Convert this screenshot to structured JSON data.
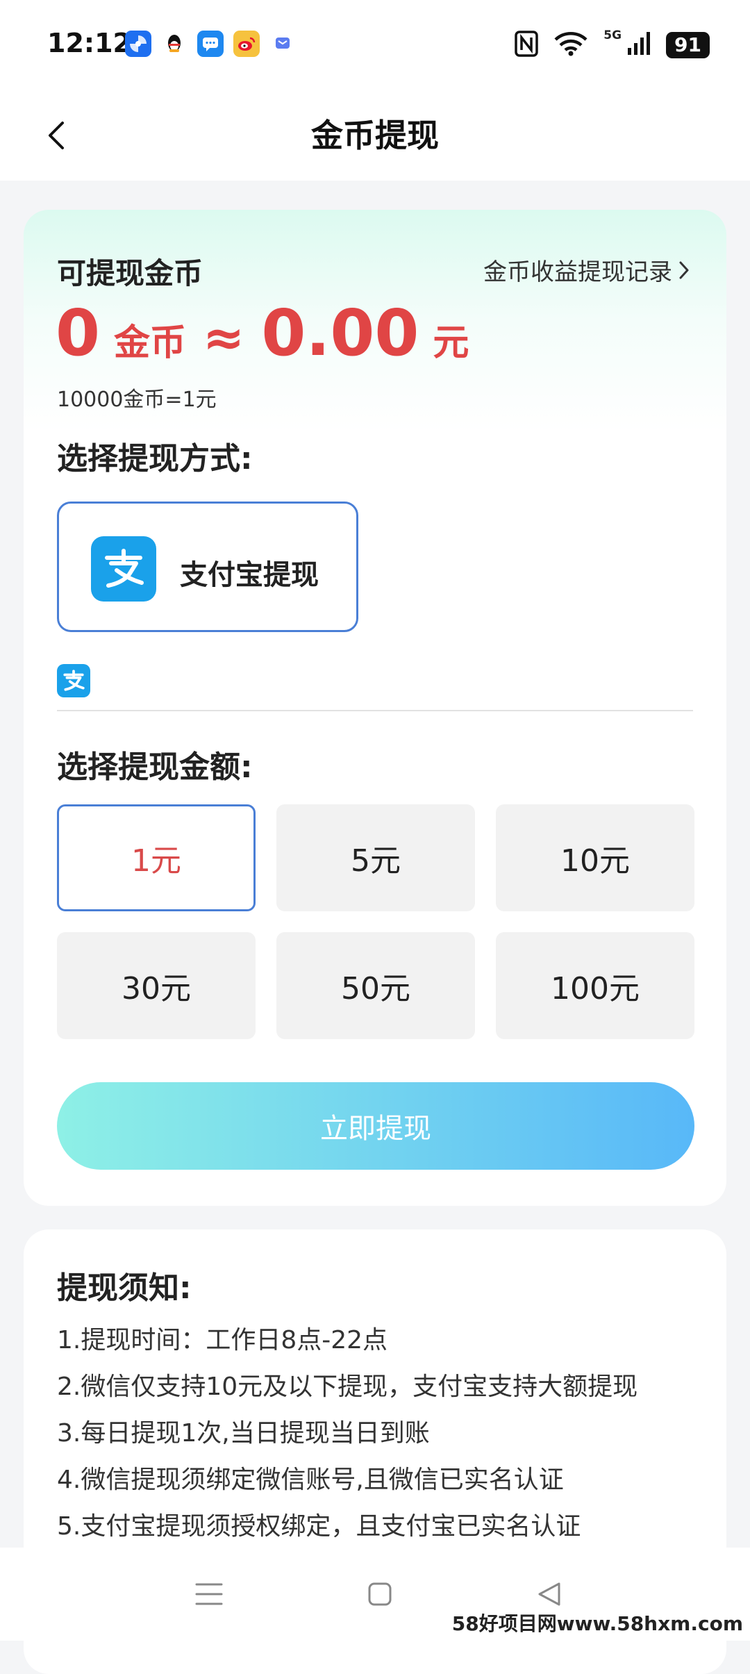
{
  "status_bar": {
    "time": "12:12",
    "network": "5G",
    "battery": "91"
  },
  "header": {
    "title": "金币提现"
  },
  "balance": {
    "label": "可提现金币",
    "history_link": "金币收益提现记录",
    "coins": "0",
    "coins_unit": "金币",
    "approx": "≈",
    "yuan": "0.00",
    "yuan_unit": "元",
    "rate_note": "10000金币=1元"
  },
  "method": {
    "section_title": "选择提现方式:",
    "option_label": "支付宝提现"
  },
  "amount": {
    "section_title": "选择提现金额:",
    "options": [
      "1元",
      "5元",
      "10元",
      "30元",
      "50元",
      "100元"
    ],
    "selected_index": 0
  },
  "withdraw_button": "立即提现",
  "rules": {
    "title": "提现须知:",
    "items": [
      "1.提现时间：工作日8点-22点",
      "2.微信仅支持10元及以下提现，支付宝支持大额提现",
      "3.每日提现1次,当日提现当日到账",
      "4.微信提现须绑定微信账号,且微信已实名认证",
      "5.支付宝提现须授权绑定，且支付宝已实名认证"
    ]
  },
  "watermark": "58好项目网www.58hxm.com",
  "colors": {
    "accent_red": "#e04545",
    "selection_blue": "#4a7fd6",
    "alipay_blue": "#1aa1ea",
    "button_gradient_start": "#8ef0e6",
    "button_gradient_end": "#58b8f8"
  }
}
